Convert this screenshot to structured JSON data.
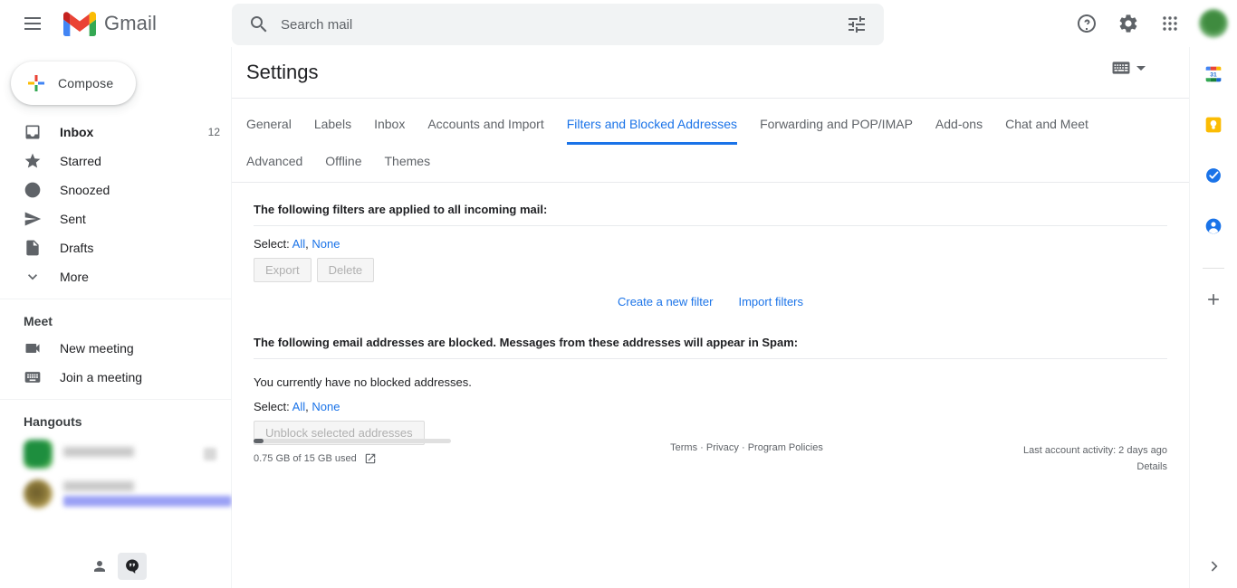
{
  "app": {
    "brand": "Gmail",
    "menu_icon": "hamburger-icon"
  },
  "search": {
    "placeholder": "Search mail",
    "value": "",
    "icon": "search-icon",
    "options_icon": "search-options-icon"
  },
  "topbar": {
    "help_icon": "help-icon",
    "settings_icon": "gear-icon",
    "apps_icon": "google-apps-icon",
    "avatar": "account-avatar"
  },
  "sidebar": {
    "compose_label": "Compose",
    "items": [
      {
        "label": "Inbox",
        "count": "12",
        "icon": "inbox-icon",
        "bold": true
      },
      {
        "label": "Starred",
        "count": "",
        "icon": "star-icon",
        "bold": false
      },
      {
        "label": "Snoozed",
        "count": "",
        "icon": "clock-icon",
        "bold": false
      },
      {
        "label": "Sent",
        "count": "",
        "icon": "send-icon",
        "bold": false
      },
      {
        "label": "Drafts",
        "count": "",
        "icon": "draft-icon",
        "bold": false
      },
      {
        "label": "More",
        "count": "",
        "icon": "chevron-down-icon",
        "bold": false
      }
    ],
    "meet": {
      "title": "Meet",
      "items": [
        {
          "label": "New meeting",
          "icon": "video-camera-icon"
        },
        {
          "label": "Join a meeting",
          "icon": "keyboard-icon"
        }
      ]
    },
    "hangouts": {
      "title": "Hangouts",
      "contacts": [
        {
          "name": "",
          "status": "",
          "redacted": true
        },
        {
          "name": "",
          "status": "",
          "redacted": true
        }
      ]
    },
    "bottom": {
      "contacts_icon": "person-icon",
      "hangouts_icon": "hangouts-chat-icon"
    }
  },
  "settings": {
    "title": "Settings",
    "input_tools_icon": "keyboard-icon",
    "input_tools_chevron": "chevron-down-icon",
    "tabs_row1": [
      {
        "label": "General",
        "active": false
      },
      {
        "label": "Labels",
        "active": false
      },
      {
        "label": "Inbox",
        "active": false
      },
      {
        "label": "Accounts and Import",
        "active": false
      },
      {
        "label": "Filters and Blocked Addresses",
        "active": true
      },
      {
        "label": "Forwarding and POP/IMAP",
        "active": false
      },
      {
        "label": "Add-ons",
        "active": false
      },
      {
        "label": "Chat and Meet",
        "active": false
      }
    ],
    "tabs_row2": [
      {
        "label": "Advanced",
        "active": false
      },
      {
        "label": "Offline",
        "active": false
      },
      {
        "label": "Themes",
        "active": false
      }
    ]
  },
  "filters_section": {
    "heading": "The following filters are applied to all incoming mail:",
    "select_label": "Select:",
    "select_all": "All",
    "select_sep": ",",
    "select_none": "None",
    "export_button": "Export",
    "delete_button": "Delete",
    "create_filter_link": "Create a new filter",
    "import_filters_link": "Import filters"
  },
  "blocked_section": {
    "heading": "The following email addresses are blocked. Messages from these addresses will appear in Spam:",
    "empty_text": "You currently have no blocked addresses.",
    "select_label": "Select:",
    "select_all": "All",
    "select_sep": ",",
    "select_none": "None",
    "unblock_button": "Unblock selected addresses"
  },
  "footer": {
    "storage_text": "0.75 GB of 15 GB used",
    "storage_percent": 5,
    "storage_link_icon": "external-link-icon",
    "legal": "Terms · Privacy · Program Policies",
    "last_activity": "Last account activity: 2 days ago",
    "details_link": "Details"
  },
  "rightrail": {
    "items": [
      {
        "icon": "google-calendar-icon"
      },
      {
        "icon": "google-keep-icon"
      },
      {
        "icon": "google-tasks-icon"
      },
      {
        "icon": "google-contacts-icon"
      }
    ],
    "add_icon": "plus-icon",
    "expand_icon": "chevron-right-icon"
  },
  "colors": {
    "accent_blue": "#1a73e8",
    "text_primary": "#202124",
    "text_secondary": "#5f6368",
    "surface": "#ffffff",
    "search_bg": "#f1f3f4"
  }
}
